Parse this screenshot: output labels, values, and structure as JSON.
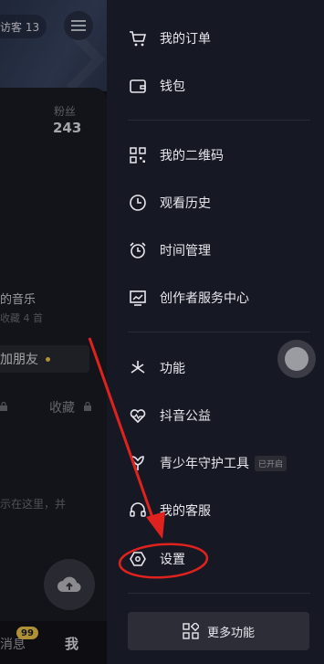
{
  "profile": {
    "visitor_label": "访客 13",
    "fans_label": "粉丝",
    "fans_value": "243",
    "music_title": "的音乐",
    "music_sub": "收藏 4 首",
    "add_friend": "加朋友",
    "tab_favorites": "收藏",
    "hint_text": "示在这里，并",
    "nav_messages": "消息",
    "nav_messages_badge": "99",
    "nav_me": "我"
  },
  "drawer": {
    "items": [
      {
        "label": "我的订单",
        "icon": "cart-icon"
      },
      {
        "label": "钱包",
        "icon": "wallet-icon"
      },
      {
        "label": "我的二维码",
        "icon": "qrcode-icon"
      },
      {
        "label": "观看历史",
        "icon": "clock-icon"
      },
      {
        "label": "时间管理",
        "icon": "alarm-icon"
      },
      {
        "label": "创作者服务中心",
        "icon": "chart-icon"
      },
      {
        "label": "功能",
        "icon": "sparkle-icon"
      },
      {
        "label": "抖音公益",
        "icon": "heart-pulse-icon"
      },
      {
        "label": "青少年守护工具",
        "icon": "youth-guard-icon",
        "tag": "已开启"
      },
      {
        "label": "我的客服",
        "icon": "headset-icon"
      },
      {
        "label": "设置",
        "icon": "settings-hex-icon"
      }
    ],
    "more_button": "更多功能"
  },
  "colors": {
    "drawer_bg": "#161823",
    "annotation_red": "#e0221f",
    "badge_yellow": "#f2c94c"
  }
}
